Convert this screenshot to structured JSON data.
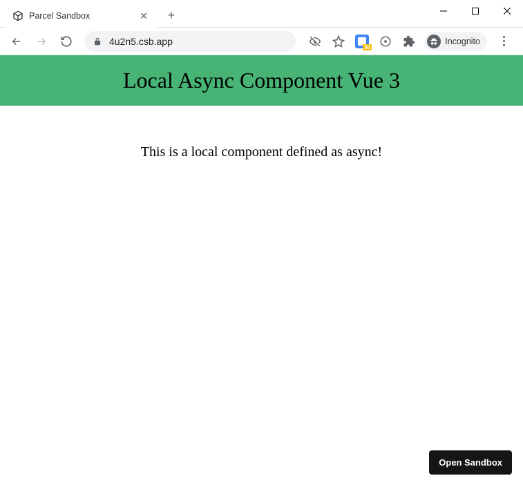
{
  "window": {
    "tab": {
      "title": "Parcel Sandbox"
    }
  },
  "toolbar": {
    "url": "4u2n5.csb.app",
    "incognito_label": "Incognito",
    "ext_badge": "3d"
  },
  "page": {
    "heading": "Local Async Component Vue 3",
    "body_text": "This is a local component defined as async!",
    "sandbox_button": "Open Sandbox"
  },
  "colors": {
    "banner": "#47b475"
  }
}
